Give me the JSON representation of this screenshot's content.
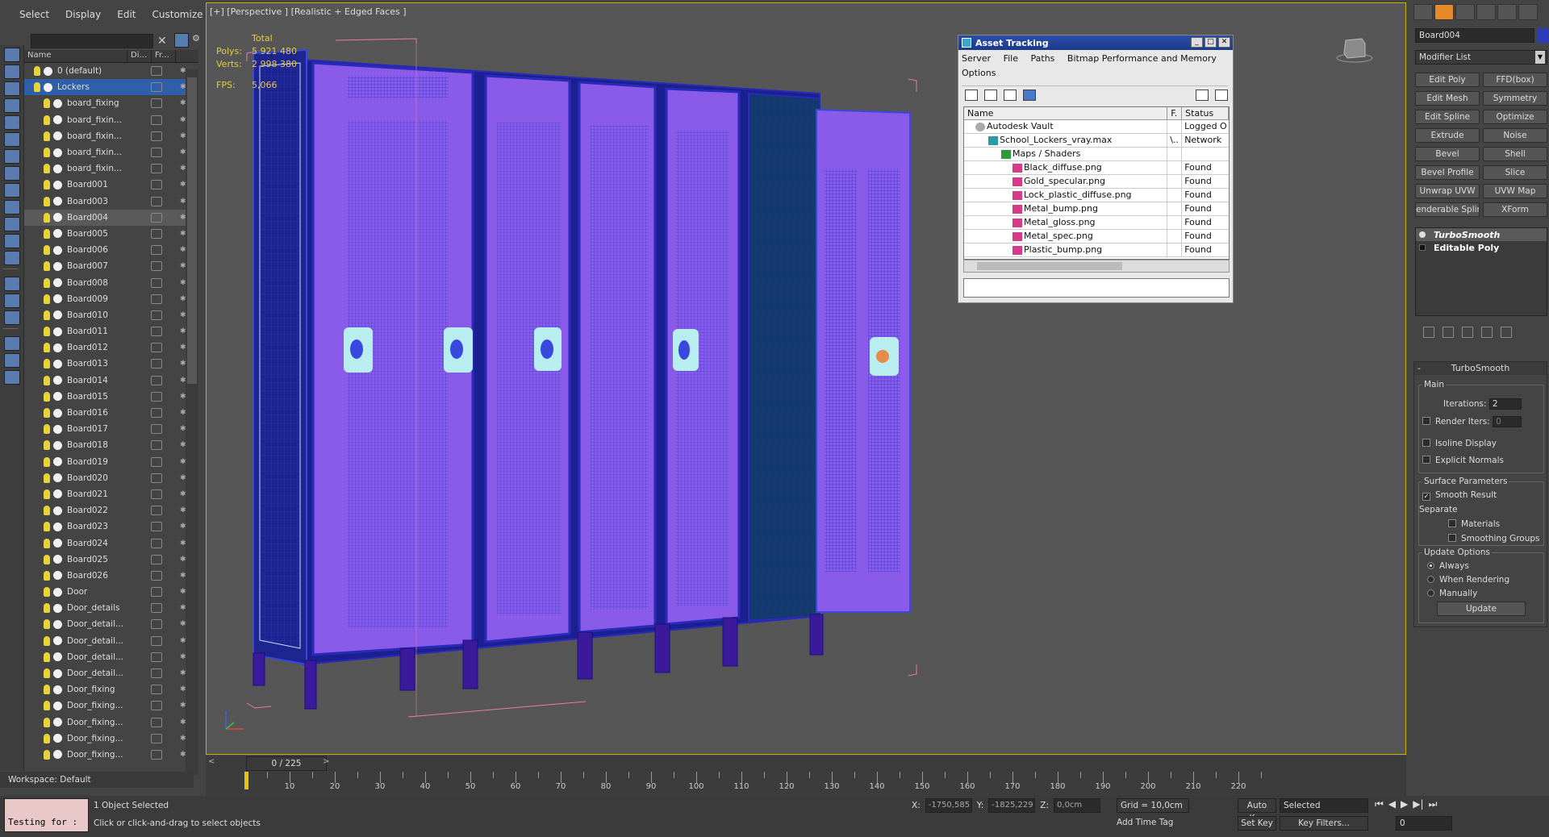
{
  "menu": [
    "Select",
    "Display",
    "Edit",
    "Customize"
  ],
  "explorer": {
    "col_name": "Name",
    "col_display": "Di...",
    "col_freeze": "Fr...",
    "rows": [
      {
        "label": "0 (default)",
        "level": 0
      },
      {
        "label": "Lockers",
        "level": 0,
        "selected": true
      },
      {
        "label": "board_fixing",
        "level": 1
      },
      {
        "label": "board_fixin...",
        "level": 1
      },
      {
        "label": "board_fixin...",
        "level": 1
      },
      {
        "label": "board_fixin...",
        "level": 1
      },
      {
        "label": "board_fixin...",
        "level": 1
      },
      {
        "label": "Board001",
        "level": 1
      },
      {
        "label": "Board003",
        "level": 1
      },
      {
        "label": "Board004",
        "level": 1,
        "selected": true
      },
      {
        "label": "Board005",
        "level": 1
      },
      {
        "label": "Board006",
        "level": 1
      },
      {
        "label": "Board007",
        "level": 1
      },
      {
        "label": "Board008",
        "level": 1
      },
      {
        "label": "Board009",
        "level": 1
      },
      {
        "label": "Board010",
        "level": 1
      },
      {
        "label": "Board011",
        "level": 1
      },
      {
        "label": "Board012",
        "level": 1
      },
      {
        "label": "Board013",
        "level": 1
      },
      {
        "label": "Board014",
        "level": 1
      },
      {
        "label": "Board015",
        "level": 1
      },
      {
        "label": "Board016",
        "level": 1
      },
      {
        "label": "Board017",
        "level": 1
      },
      {
        "label": "Board018",
        "level": 1
      },
      {
        "label": "Board019",
        "level": 1
      },
      {
        "label": "Board020",
        "level": 1
      },
      {
        "label": "Board021",
        "level": 1
      },
      {
        "label": "Board022",
        "level": 1
      },
      {
        "label": "Board023",
        "level": 1
      },
      {
        "label": "Board024",
        "level": 1
      },
      {
        "label": "Board025",
        "level": 1
      },
      {
        "label": "Board026",
        "level": 1
      },
      {
        "label": "Door",
        "level": 1
      },
      {
        "label": "Door_details",
        "level": 1
      },
      {
        "label": "Door_detail...",
        "level": 1
      },
      {
        "label": "Door_detail...",
        "level": 1
      },
      {
        "label": "Door_detail...",
        "level": 1
      },
      {
        "label": "Door_detail...",
        "level": 1
      },
      {
        "label": "Door_fixing",
        "level": 1
      },
      {
        "label": "Door_fixing...",
        "level": 1
      },
      {
        "label": "Door_fixing...",
        "level": 1
      },
      {
        "label": "Door_fixing...",
        "level": 1
      },
      {
        "label": "Door_fixing...",
        "level": 1
      }
    ]
  },
  "workspace": "Workspace: Default",
  "viewport": {
    "label": "[+] [Perspective ] [Realistic + Edged Faces ]",
    "stats": {
      "total": "Total",
      "polys_label": "Polys:",
      "polys": "5 921 480",
      "verts_label": "Verts:",
      "verts": "2 998 380",
      "fps_label": "FPS:",
      "fps": "5,066"
    }
  },
  "asset": {
    "title": "Asset Tracking",
    "menu": [
      "Server",
      "File",
      "Paths",
      "Bitmap Performance and Memory",
      "Options"
    ],
    "cols": {
      "name": "Name",
      "f": "F.",
      "status": "Status"
    },
    "rows": [
      {
        "name": "Autodesk Vault",
        "f": "",
        "status": "Logged O",
        "icon": "vault",
        "indent": 14
      },
      {
        "name": "School_Lockers_vray.max",
        "f": "\\..",
        "status": "Network",
        "icon": "max",
        "indent": 30
      },
      {
        "name": "Maps / Shaders",
        "f": "",
        "status": "",
        "icon": "folder",
        "indent": 46
      },
      {
        "name": "Black_diffuse.png",
        "f": "",
        "status": "Found",
        "icon": "png",
        "indent": 60
      },
      {
        "name": "Gold_specular.png",
        "f": "",
        "status": "Found",
        "icon": "png",
        "indent": 60
      },
      {
        "name": "Lock_plastic_diffuse.png",
        "f": "",
        "status": "Found",
        "icon": "png",
        "indent": 60
      },
      {
        "name": "Metal_bump.png",
        "f": "",
        "status": "Found",
        "icon": "png",
        "indent": 60
      },
      {
        "name": "Metal_gloss.png",
        "f": "",
        "status": "Found",
        "icon": "png",
        "indent": 60
      },
      {
        "name": "Metal_spec.png",
        "f": "",
        "status": "Found",
        "icon": "png",
        "indent": 60
      },
      {
        "name": "Plastic_bump.png",
        "f": "",
        "status": "Found",
        "icon": "png",
        "indent": 60
      }
    ]
  },
  "command": {
    "object_name": "Board004",
    "object_color": "#2a3ab8",
    "modifier_list": "Modifier List",
    "buttons": [
      "Edit Poly",
      "FFD(box)",
      "Edit Mesh",
      "Symmetry",
      "Edit Spline",
      "Optimize",
      "Extrude",
      "Noise",
      "Bevel",
      "Shell",
      "Bevel Profile",
      "Slice",
      "Unwrap UVW",
      "UVW Map",
      "enderable Splin",
      "XForm"
    ],
    "stack": [
      "TurboSmooth",
      "Editable Poly"
    ],
    "rollout": {
      "title": "TurboSmooth",
      "minus": "-",
      "main": "Main",
      "iterations_label": "Iterations:",
      "iterations": "2",
      "render_iters_label": "Render Iters:",
      "render_iters": "0",
      "isoline": "Isoline Display",
      "explicit": "Explicit Normals",
      "surface": "Surface Parameters",
      "smooth_result": "Smooth Result",
      "separate": "Separate",
      "materials": "Materials",
      "smoothing_groups": "Smoothing Groups",
      "update_options": "Update Options",
      "always": "Always",
      "when_rendering": "When Rendering",
      "manually": "Manually",
      "update": "Update"
    }
  },
  "timeline": {
    "slider": "0 / 225",
    "ticks": [
      0,
      5,
      10,
      15,
      20,
      25,
      30,
      35,
      40,
      45,
      50,
      55,
      60,
      65,
      70,
      75,
      80,
      85,
      90,
      95,
      100,
      105,
      110,
      115,
      120,
      125,
      130,
      135,
      140,
      145,
      150,
      155,
      160,
      165,
      170,
      175,
      180,
      185,
      190,
      195,
      200,
      205,
      210,
      215,
      220,
      225
    ],
    "labels": [
      "10",
      "20",
      "30",
      "40",
      "50",
      "60",
      "70",
      "80",
      "90",
      "100",
      "110",
      "120",
      "130",
      "140",
      "150",
      "160",
      "170",
      "180",
      "190",
      "200",
      "210",
      "220"
    ]
  },
  "status": {
    "maxscript": "Testing for :",
    "selected": "1 Object Selected",
    "prompt": "Click or click-and-drag to select objects",
    "x_label": "X:",
    "x": "-1750,585",
    "y_label": "Y:",
    "y": "-1825,229",
    "z_label": "Z:",
    "z": "0,0cm",
    "grid": "Grid = 10,0cm",
    "add_time_tag": "Add Time Tag",
    "auto_key": "Auto Key",
    "set_key": "Set Key",
    "selected_dd": "Selected",
    "key_filters": "Key Filters...",
    "frame": "0"
  }
}
